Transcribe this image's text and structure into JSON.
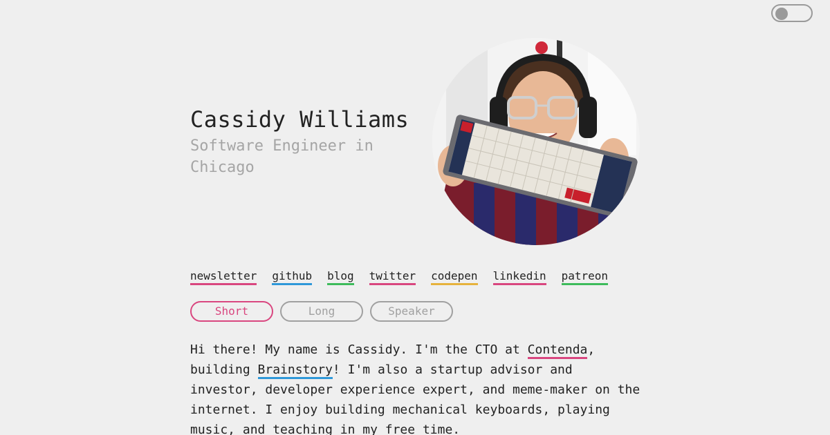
{
  "toggle": {
    "state": "off"
  },
  "header": {
    "name": "Cassidy Williams",
    "subtitle": "Software Engineer in Chicago"
  },
  "avatar": {
    "icon": "profile-photo"
  },
  "links": [
    {
      "label": "newsletter",
      "color": "#d9467f"
    },
    {
      "label": "github",
      "color": "#2e98d9"
    },
    {
      "label": "blog",
      "color": "#3dbb5b"
    },
    {
      "label": "twitter",
      "color": "#d9467f"
    },
    {
      "label": "codepen",
      "color": "#e6b23c"
    },
    {
      "label": "linkedin",
      "color": "#d9467f"
    },
    {
      "label": "patreon",
      "color": "#3dbb5b"
    }
  ],
  "tabs": [
    {
      "label": "Short",
      "active": true
    },
    {
      "label": "Long",
      "active": false
    },
    {
      "label": "Speaker",
      "active": false
    }
  ],
  "bio": {
    "part1": "Hi there! My name is Cassidy. I'm the CTO at ",
    "link1": "Contenda",
    "link1_color": "#d9467f",
    "part2": ", building ",
    "link2": "Brainstory",
    "link2_color": "#2e98d9",
    "part3": "! I'm also a startup advisor and investor, developer experience expert, and meme-maker on the internet. I enjoy building mechanical keyboards, playing music, and teaching in my free time."
  },
  "colors": {
    "accent": "#d9467f",
    "muted": "#a5a5a5",
    "background": "#efefef"
  }
}
